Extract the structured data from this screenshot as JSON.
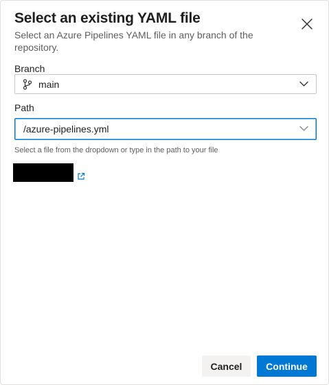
{
  "dialog": {
    "title": "Select an existing YAML file",
    "subtitle": "Select an Azure Pipelines YAML file in any branch of the repository."
  },
  "branch": {
    "label": "Branch",
    "value": "main",
    "icon": "git-branch-icon"
  },
  "path": {
    "label": "Path",
    "value": "/azure-pipelines.yml",
    "hint": "Select a file from the dropdown or type in the path to your file"
  },
  "link": {
    "icon": "external-link-icon"
  },
  "footer": {
    "cancel_label": "Cancel",
    "continue_label": "Continue"
  },
  "colors": {
    "accent": "#0078d4",
    "border": "#c8c6c4",
    "secondary_button_bg": "#f3f2f1"
  }
}
